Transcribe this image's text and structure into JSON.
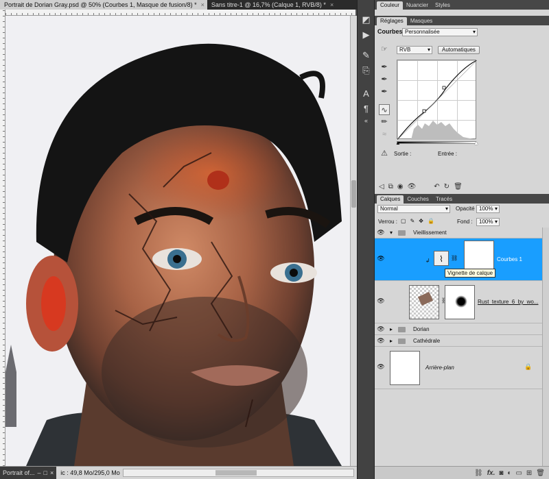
{
  "doc_tabs": [
    {
      "label": "Portrait de Dorian Gray.psd @ 50% (Courbes 1, Masque de fusion/8) *",
      "close": "×",
      "active": true
    },
    {
      "label": "Sans titre-1 @ 16,7% (Calque 1, RVB/8) *",
      "close": "×",
      "active": false
    }
  ],
  "status": {
    "mini_title": "Portrait of...",
    "mini_buttons": [
      "–",
      "□",
      "×"
    ],
    "doc_info": "ic : 49,8 Mo/295,0 Mo"
  },
  "dock_icons": [
    "swatch-icon",
    "play-icon",
    "brush-preset-icon",
    "clone-source-icon",
    "text-icon",
    "paragraph-icon"
  ],
  "color_panel": {
    "tabs": [
      "Couleur",
      "Nuancier",
      "Styles"
    ]
  },
  "adjust_panel": {
    "tabs": [
      "Réglages",
      "Masques"
    ],
    "title": "Courbes",
    "preset": "Personnalisée",
    "channel": "RVB",
    "auto_button": "Automatiques",
    "output_label": "Sortie :",
    "input_label": "Entrée :"
  },
  "layers_panel": {
    "tabs": [
      "Calques",
      "Couches",
      "Tracés"
    ],
    "blend_mode": "Normal",
    "opacity_label": "Opacité :",
    "opacity_value": "100%",
    "lock_label": "Verrou :",
    "fill_label": "Fond :",
    "fill_value": "100%",
    "layers": [
      {
        "name": "Vieillissement",
        "type": "group"
      },
      {
        "name": "Courbes 1",
        "type": "adjustment",
        "selected": true
      },
      {
        "name": "Rust_texture_6_by_wo...",
        "type": "image"
      },
      {
        "name": "Dorian",
        "type": "group"
      },
      {
        "name": "Cathédrale",
        "type": "group"
      },
      {
        "name": "Arrière-plan",
        "type": "background"
      }
    ],
    "tooltip": "Vignette de calque"
  },
  "colors": {
    "selection": "#199eff",
    "panel_bg": "#d6d6d6",
    "dark_ui": "#424242"
  }
}
